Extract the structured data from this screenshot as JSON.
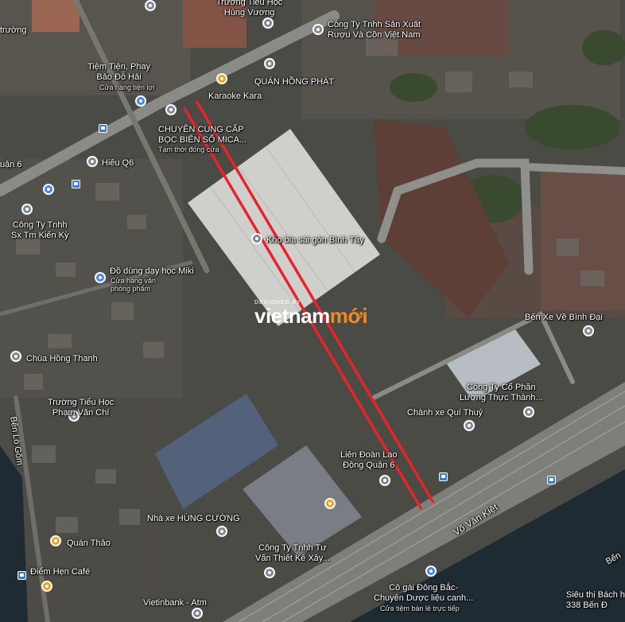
{
  "watermark": {
    "designed_by": "DESIGNED BY",
    "brand_a": "vietnam",
    "brand_b": "mới"
  },
  "colors": {
    "route_line": "#e8232a",
    "water": "#1e2a33",
    "road": "#8a8a86",
    "roof_light": "#c9c9c6"
  },
  "labels": {
    "truong_tieu_hoc_hung_vuong": "Trường Tiểu Học\nHùng Vương",
    "cong_ty_san_xuat_ruou": "Công Ty Tnhh Sản Xuất\nRượu Và Cồn Việt Nam",
    "tiem_tien_phay": "Tiệm Tiện, Phay\nBảo Đỗ Hải",
    "tiem_tien_phay_sub": "Cửa hàng tiện lợi",
    "quan_hong_phat": "QUÁN HỒNG PHÁT",
    "karaoke_kara": "Karaoke Kara",
    "chuyen_cung_cap": "CHUYÊN CUNG CẤP\nBỌC BIỂN SỐ MICA...",
    "chuyen_cung_cap_sub": "Tạm thời đóng cửa",
    "truong_left": "trường",
    "hieu_q6": "Hiếu Q6",
    "quan_6": "uận 6",
    "cong_ty_kien_ky": "Công Ty Tnhh\nSx Tm Kiến Kỳ",
    "kho_bia": "Kho bia sài gòn Bình Tây",
    "do_dung_day_hoc": "Đồ dùng dạy học Miki",
    "do_dung_sub": "Cửa hàng văn\nphòng phẩm",
    "ben_xe_ve_binh_dai": "Bến Xe Về Bình Đại",
    "chua_hong_thanh": "Chùa Hồng Thanh",
    "cong_ty_luong_thuc": "Công Ty Cổ Phần\nLương Thực Thành...",
    "truong_pham_van_chi": "Trường Tiểu Học\nPhạm Văn Chí",
    "chanh_xe_qui_thuy": "Chành xe Quí Thuỷ",
    "lien_doan_lao_dong": "Liên Đoàn Lao\nĐộng Quận 6",
    "ben_lo_gom": "Bến Lò Gốm",
    "nha_xe_hung_cuong": "Nhà xe HÙNG CƯỜNG",
    "vo_van_kiet": "Võ Văn Kiệt",
    "quan_thao": "Quán Thảo",
    "cong_ty_tu_van": "Công Ty Tnhh Tư\nVấn Thiết Kế Xây...",
    "diem_hen_cafe": "Điểm Hẹn Café",
    "co_gai_dong_bac": "Cô gái Đông Bắc-\nChuyên Dược liệu canh...",
    "co_gai_sub": "Cửa tiệm bán lẻ trực tiếp",
    "vietinbank": "Vietinbank - Atm",
    "sieu_thi": "Siêu thị Bách h\n338 Bến Đ",
    "ben_right": "Bến"
  }
}
